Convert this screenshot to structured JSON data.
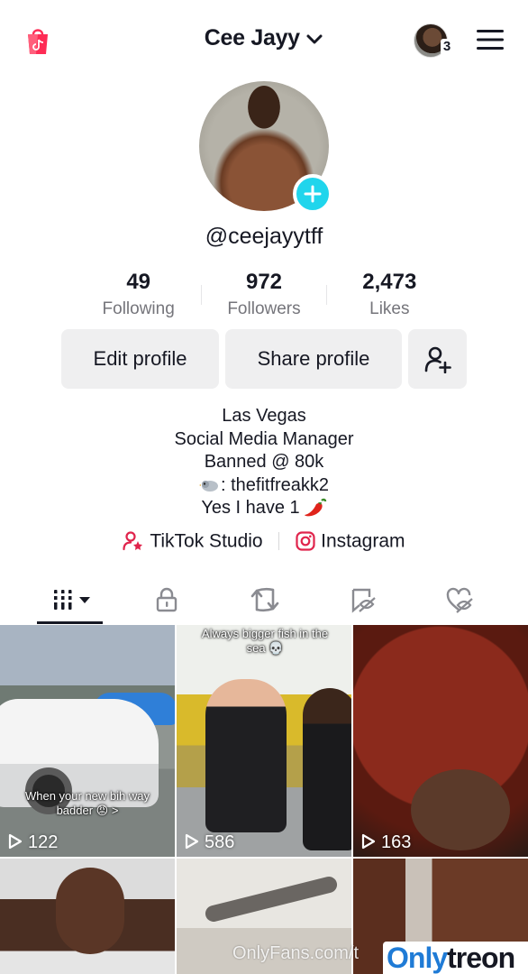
{
  "header": {
    "title": "Cee Jayy",
    "account_count": "3"
  },
  "profile": {
    "handle": "@ceejayytff",
    "stats": [
      {
        "value": "49",
        "label": "Following"
      },
      {
        "value": "972",
        "label": "Followers"
      },
      {
        "value": "2,473",
        "label": "Likes"
      }
    ],
    "buttons": {
      "edit": "Edit profile",
      "share": "Share profile"
    },
    "bio": {
      "line1": "Las Vegas",
      "line2": "Social Media Manager",
      "line3": "Banned @ 80k",
      "line4": ": thefitfreakk2",
      "line5": "Yes I have 1"
    },
    "links": {
      "studio": "TikTok Studio",
      "instagram": "Instagram"
    }
  },
  "tabs": [
    "videos",
    "private",
    "reposts",
    "hidden",
    "liked"
  ],
  "videos": [
    {
      "views": "122",
      "caption": "When your new bih way badder 😡 >"
    },
    {
      "views": "586",
      "caption": "Always bigger fish in the sea 💀"
    },
    {
      "views": "163",
      "caption": ""
    },
    {
      "views": "",
      "caption": ""
    },
    {
      "views": "",
      "caption": ""
    },
    {
      "views": "",
      "caption": ""
    }
  ],
  "watermarks": {
    "site": "OnlyFans.com/t",
    "brand_a": "Only",
    "brand_b": "treon"
  },
  "colors": {
    "accent": "#20d5ec",
    "text": "#161823",
    "muted": "#75757b",
    "button_bg": "#efeff0",
    "shop": "#fe2c55"
  }
}
